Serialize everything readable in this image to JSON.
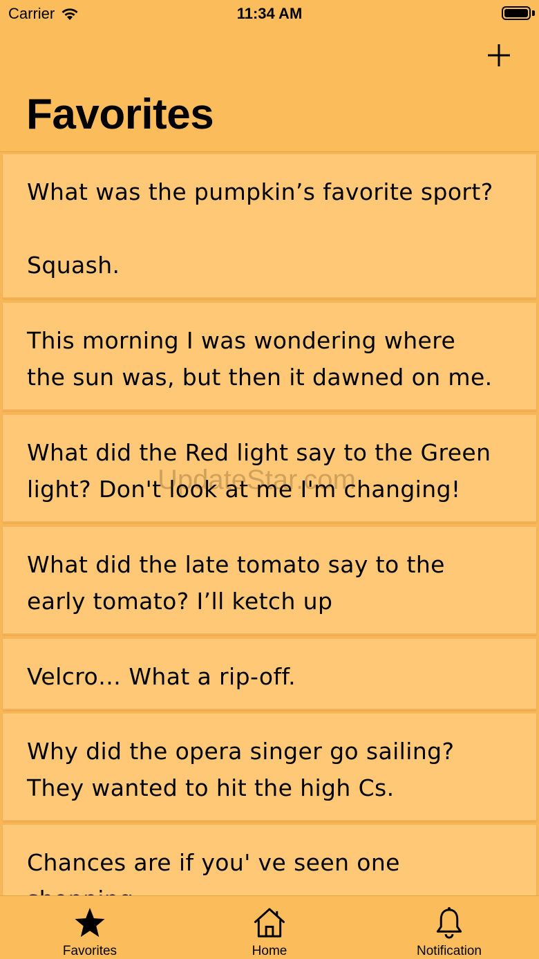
{
  "status": {
    "carrier": "Carrier",
    "time": "11:34 AM"
  },
  "nav": {
    "title": "Favorites",
    "add_icon": "plus-icon"
  },
  "watermark": "UpdateStar.com",
  "jokes": [
    "What was the pumpkin’s favorite sport?\n\nSquash.",
    "This morning I was wondering where\nthe sun was, but then it dawned on me.",
    "What did the Red light say to the Green\nlight? Don't look at me I'm changing!",
    "What did the late tomato say to the\nearly tomato? I’ll ketch up",
    "Velcro… What a rip-off.",
    "Why did the opera singer go sailing?\nThey wanted to hit the high Cs.",
    "Chances are if you' ve seen one shopping\ncenter, you've seen a mall."
  ],
  "tabs": [
    {
      "label": "Favorites",
      "icon": "star-icon"
    },
    {
      "label": "Home",
      "icon": "house-icon"
    },
    {
      "label": "Notification",
      "icon": "bell-icon"
    }
  ],
  "colors": {
    "background": "#fbbd5b",
    "card": "#fec877"
  }
}
